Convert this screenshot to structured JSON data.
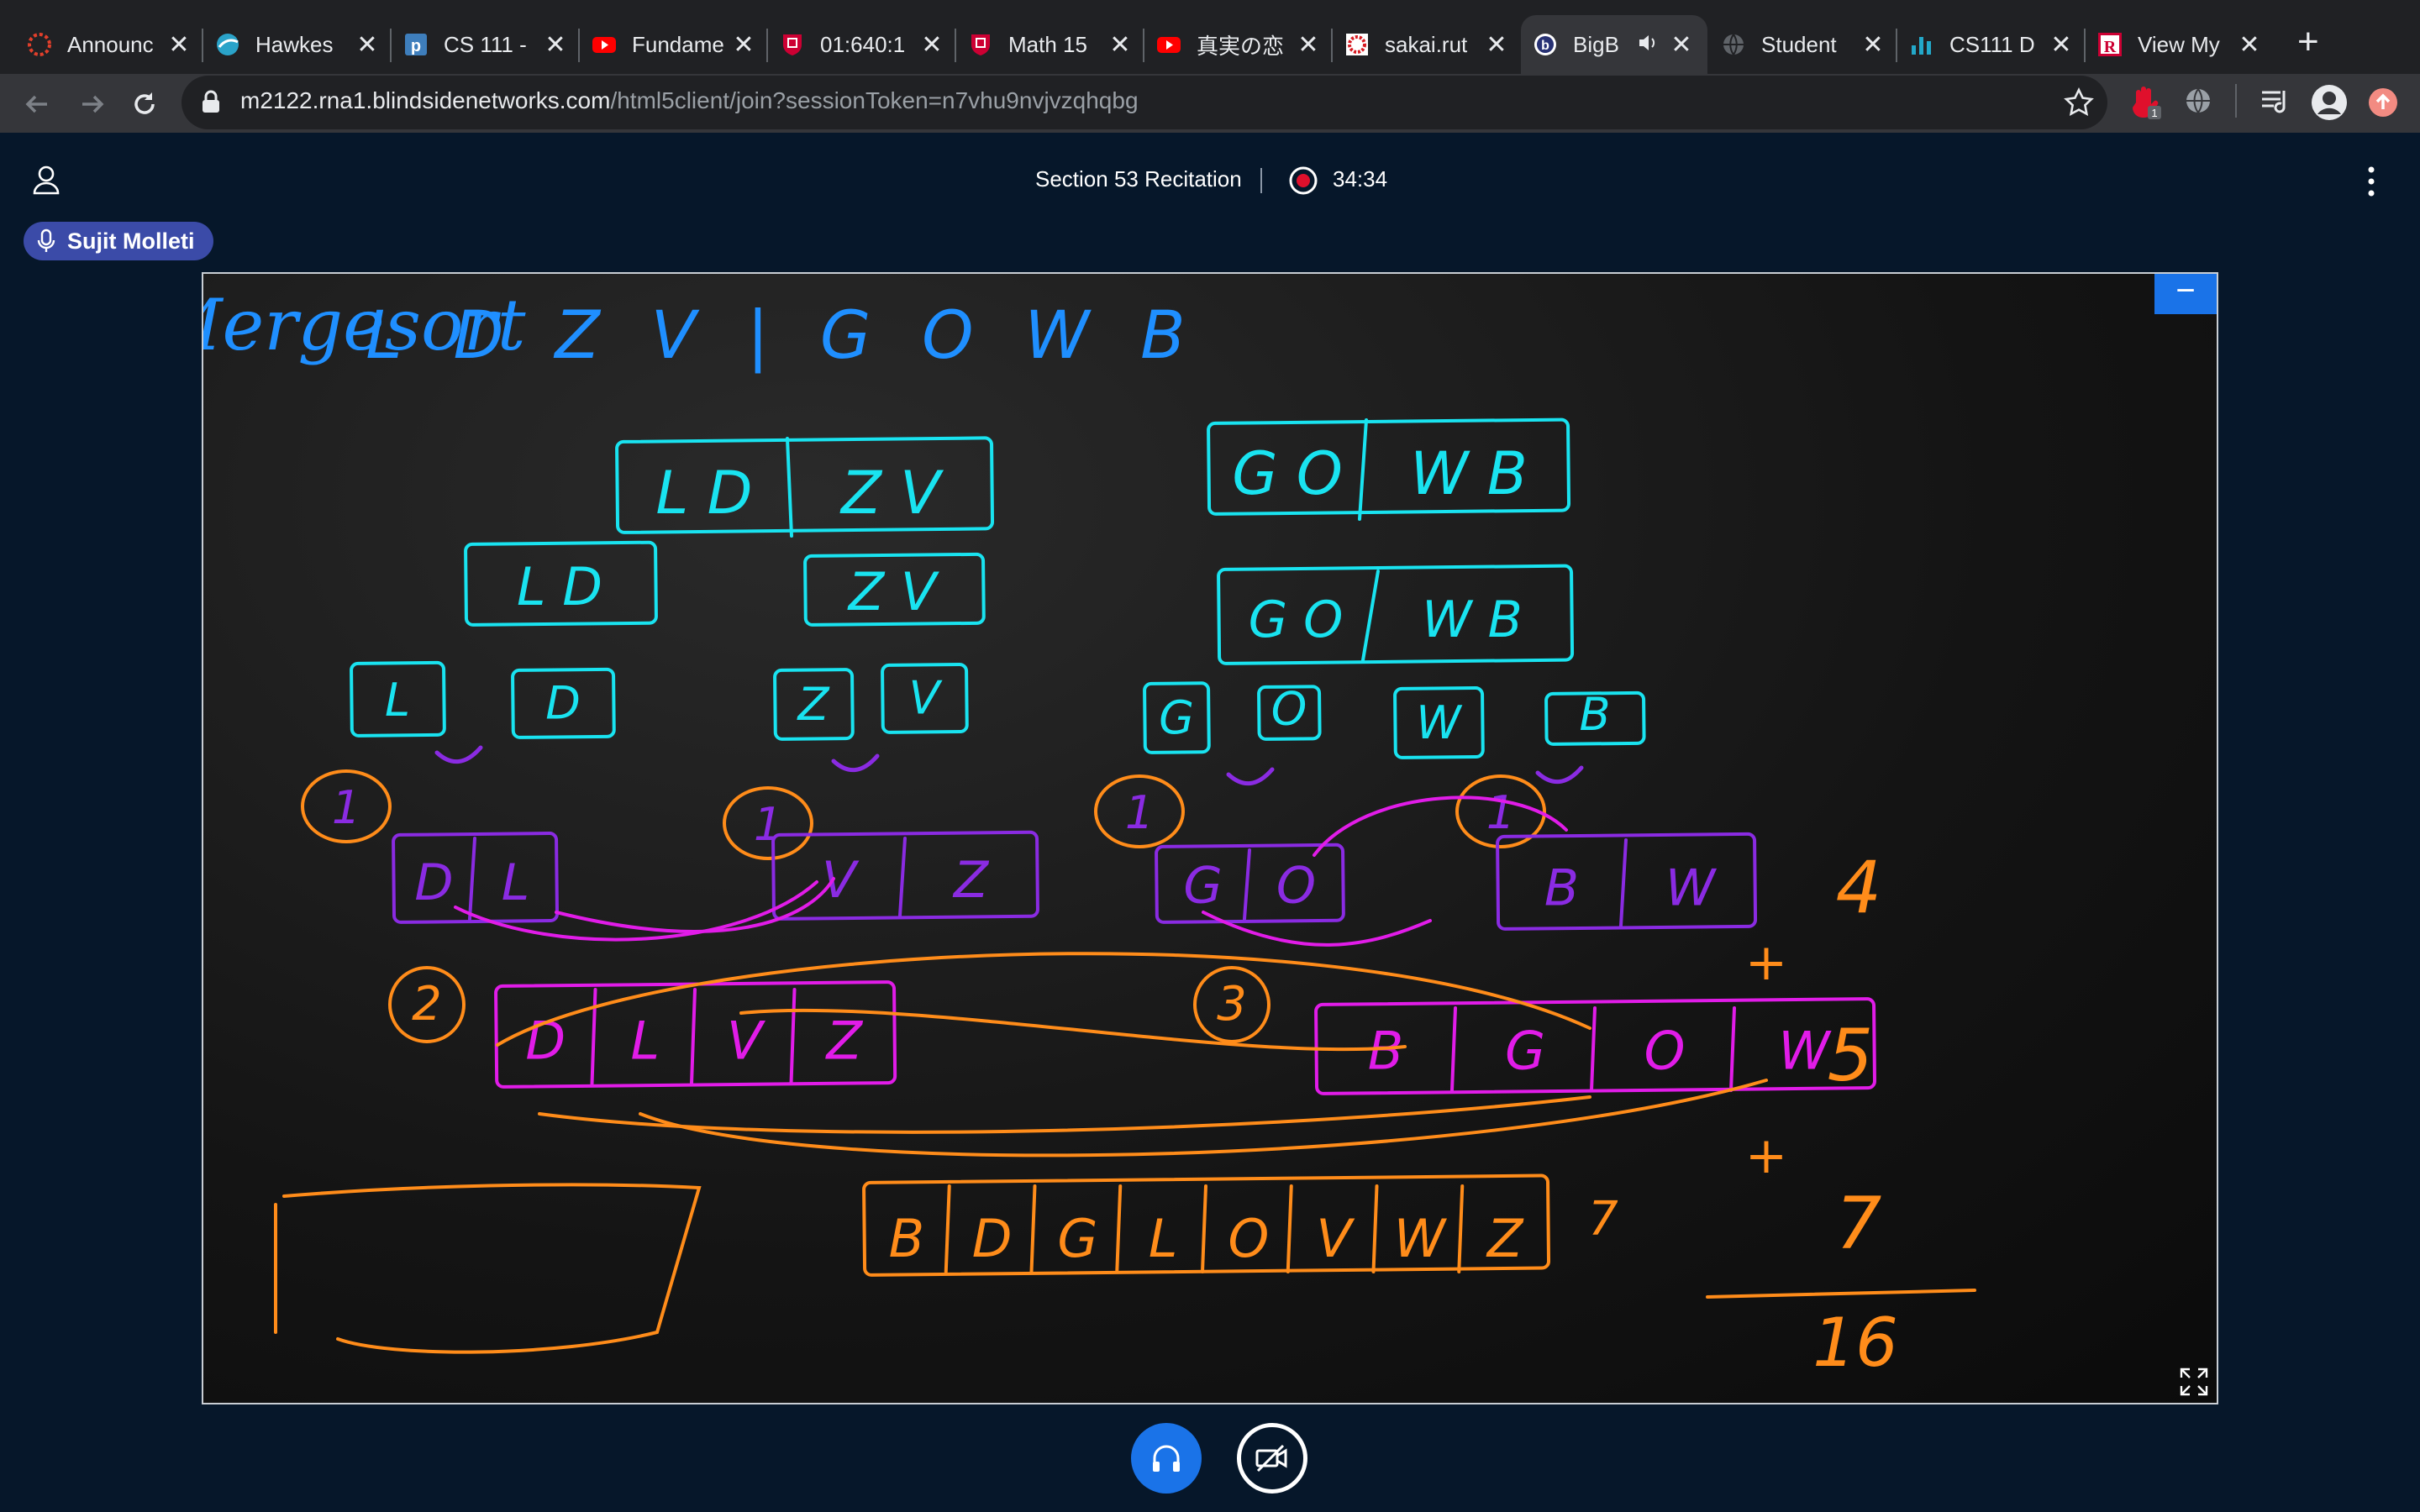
{
  "browser": {
    "tabs": [
      {
        "title": "Announc",
        "icon": "canvas-icon"
      },
      {
        "title": "Hawkes",
        "icon": "hawkes-icon"
      },
      {
        "title": "CS 111 -",
        "icon": "piazza-icon"
      },
      {
        "title": "Fundame",
        "icon": "youtube-icon"
      },
      {
        "title": "01:640:1",
        "icon": "rutgers-shield-icon"
      },
      {
        "title": "Math 15",
        "icon": "rutgers-shield-icon"
      },
      {
        "title": "真実の恋",
        "icon": "youtube-icon"
      },
      {
        "title": "sakai.rut",
        "icon": "sakai-icon"
      },
      {
        "title": "BigB",
        "icon": "bigbluebutton-icon",
        "active": true
      },
      {
        "title": "Student",
        "icon": "globe-icon"
      },
      {
        "title": "CS111 D",
        "icon": "bar-chart-icon"
      },
      {
        "title": "View My",
        "icon": "rutgers-r-icon"
      }
    ],
    "new_tab": "+",
    "url_host": "m2122.rna1.blindsidenetworks.com",
    "url_path": "/html5client/join?sessionToken=n7vhu9nvjvzqhqbg",
    "extension_badge": "1"
  },
  "meeting": {
    "title": "Section 53 Recitation",
    "recording_time": "34:34",
    "presenter": "Sujit Molleti",
    "minimize": "−"
  },
  "whiteboard": {
    "heading": "Mergesort",
    "input": "L D Z V | G O W B",
    "level1": [
      "L D",
      "Z V",
      "G O",
      "W B"
    ],
    "level2": [
      "L D",
      "Z V",
      "G O",
      "W B"
    ],
    "singles": [
      "L",
      "D",
      "Z",
      "V",
      "G",
      "O",
      "W",
      "B"
    ],
    "merged_pairs": [
      [
        "D",
        "L"
      ],
      [
        "V",
        "Z"
      ],
      [
        "G",
        "O"
      ],
      [
        "B",
        "W"
      ]
    ],
    "pair_counts": [
      "1",
      "1",
      "1",
      "1"
    ],
    "merged_halves": [
      [
        "D",
        "L",
        "V",
        "Z"
      ],
      [
        "B",
        "G",
        "O",
        "W"
      ]
    ],
    "half_counts": [
      "2",
      "3"
    ],
    "final": [
      "B",
      "D",
      "G",
      "L",
      "O",
      "V",
      "W",
      "Z"
    ],
    "final_count": "7",
    "sum_terms": [
      "4",
      "+",
      "5",
      "+",
      "7"
    ],
    "sum_total": "16"
  },
  "colors": {
    "heading": "#1f8fff",
    "cyan": "#19e3f0",
    "purple": "#8a2be2",
    "magenta": "#e11ce8",
    "orange": "#ff8c1a",
    "accent": "#1a73e8",
    "record": "#e0102c"
  }
}
